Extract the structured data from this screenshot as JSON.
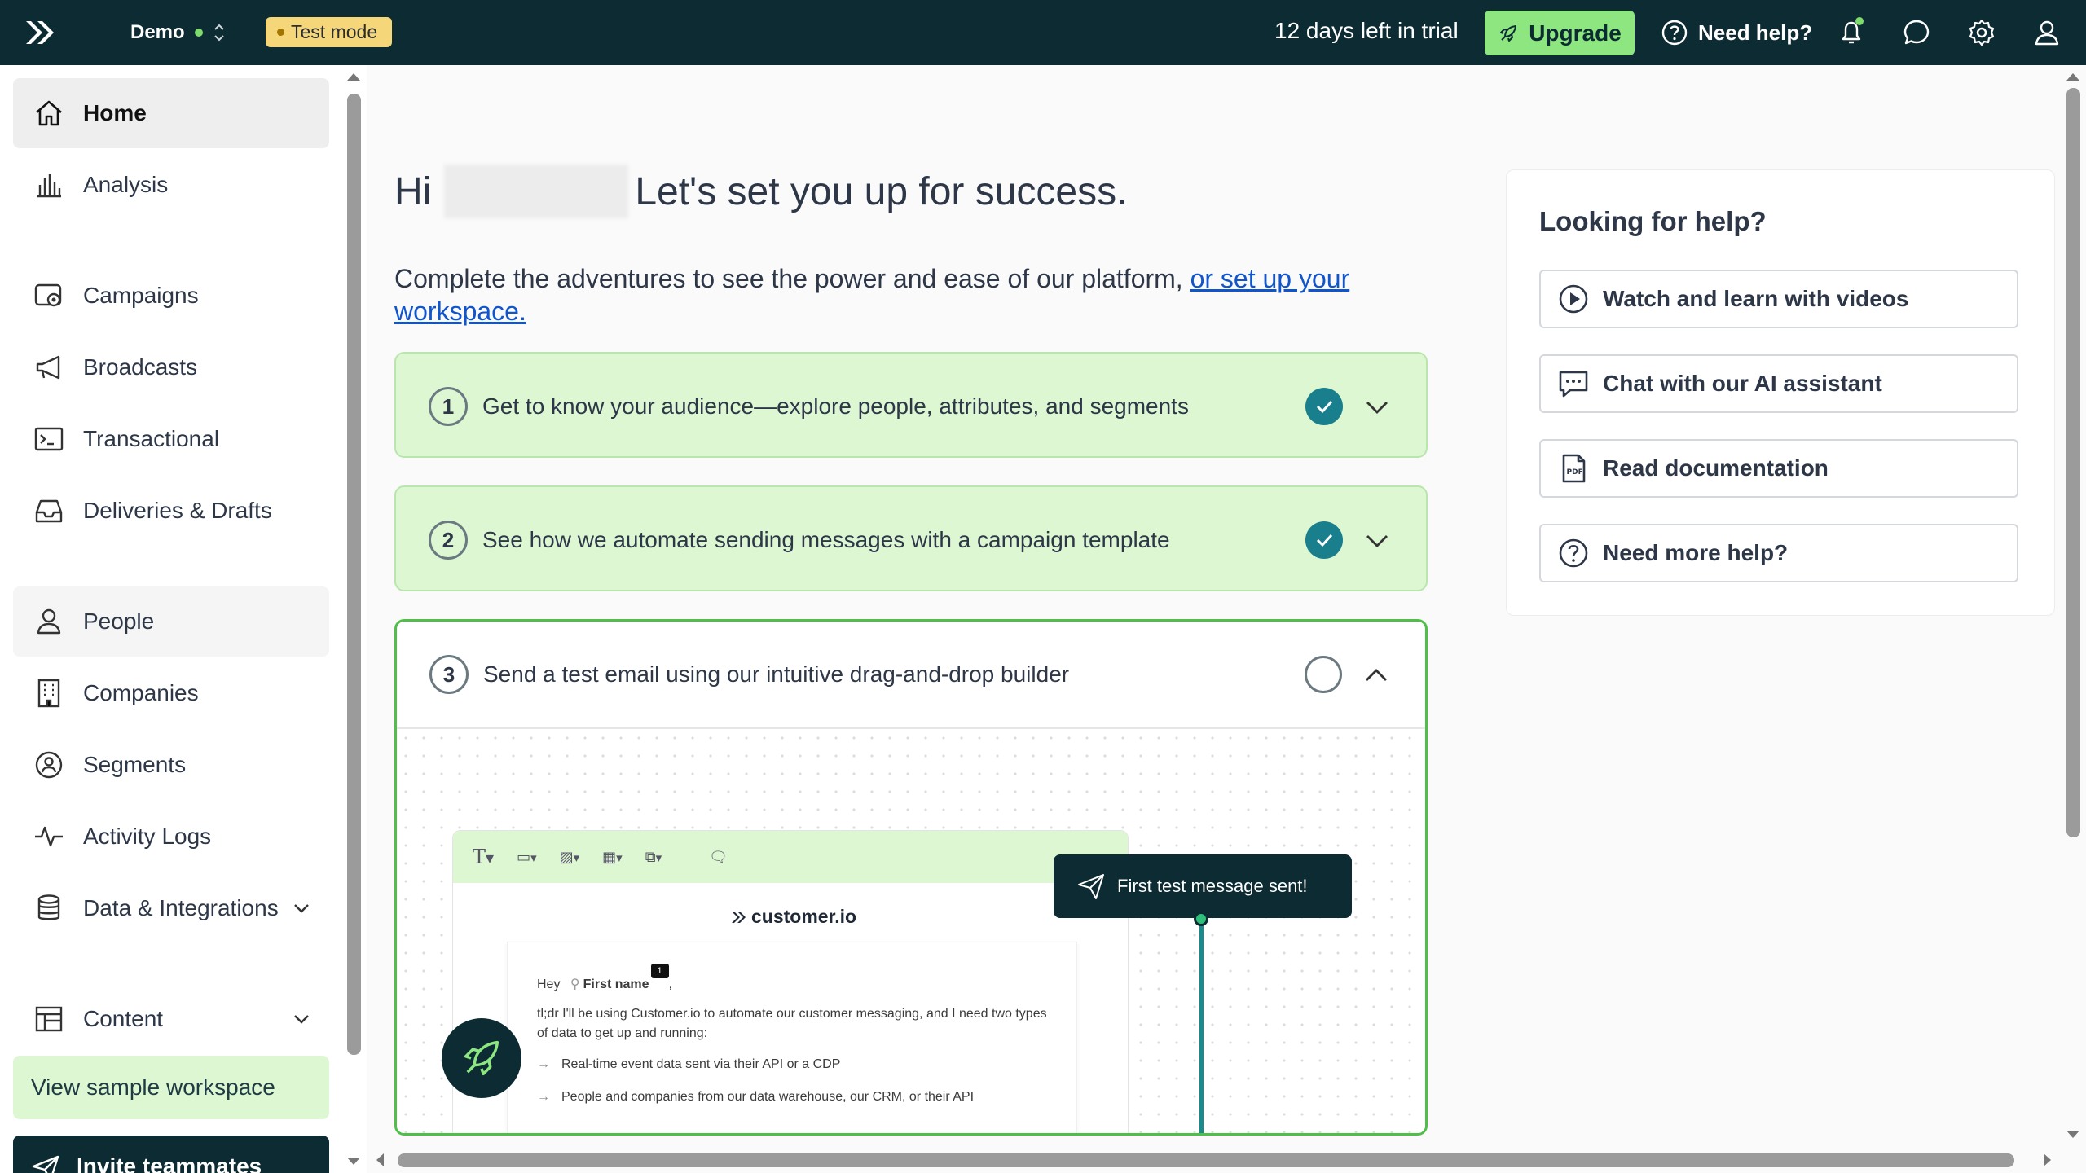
{
  "topbar": {
    "workspace": "Demo",
    "test_mode": "Test mode",
    "trial": "12 days left in trial",
    "upgrade": "Upgrade",
    "need_help": "Need help?",
    "icons": [
      "logo-icon",
      "rocket-icon",
      "help-circle-icon",
      "bell-icon",
      "chat-icon",
      "gear-icon",
      "user-icon"
    ]
  },
  "sidebar": {
    "items": [
      {
        "label": "Home"
      },
      {
        "label": "Analysis"
      },
      {
        "label": "Campaigns"
      },
      {
        "label": "Broadcasts"
      },
      {
        "label": "Transactional"
      },
      {
        "label": "Deliveries & Drafts"
      },
      {
        "label": "People"
      },
      {
        "label": "Companies"
      },
      {
        "label": "Segments"
      },
      {
        "label": "Activity Logs"
      },
      {
        "label": "Data & Integrations"
      },
      {
        "label": "Content"
      }
    ],
    "sample_workspace": "View sample workspace",
    "invite": "Invite teammates"
  },
  "main": {
    "greeting_prefix": "Hi",
    "greeting_suffix": "Let's set you up for success.",
    "intro_text": "Complete the adventures to see the power and ease of our platform, ",
    "intro_link": "or set up your workspace.",
    "steps": [
      {
        "number": "1",
        "label": "Get to know your audience—explore people, attributes, and segments",
        "status": "complete"
      },
      {
        "number": "2",
        "label": "See how we automate sending messages with a campaign template",
        "status": "complete"
      },
      {
        "number": "3",
        "label": "Send a test email using our intuitive drag-and-drop builder",
        "status": "incomplete"
      }
    ],
    "preview": {
      "brand": "customer.io",
      "hey": "Hey",
      "first_name": "First name",
      "comment_count": "1",
      "body": "tl;dr I'll be using Customer.io to automate our customer messaging, and I need two types of data to get up and running:",
      "bullets": [
        "Real-time event data sent via their API or a CDP",
        "People and companies from our data warehouse, our CRM, or their API"
      ],
      "toast": "First test message sent!"
    }
  },
  "help_panel": {
    "title": "Looking for help?",
    "buttons": [
      {
        "label": "Watch and learn with videos",
        "icon": "play-icon"
      },
      {
        "label": "Chat with our AI assistant",
        "icon": "chat-dots-icon"
      },
      {
        "label": "Read documentation",
        "icon": "pdf-icon"
      },
      {
        "label": "Need more help?",
        "icon": "question-icon"
      }
    ]
  },
  "colors": {
    "topbar": "#0d2b33",
    "accent_green": "#8ee680",
    "step_done_bg": "#def7d3",
    "check_teal": "#1a7f8c",
    "link": "#1155cc"
  }
}
